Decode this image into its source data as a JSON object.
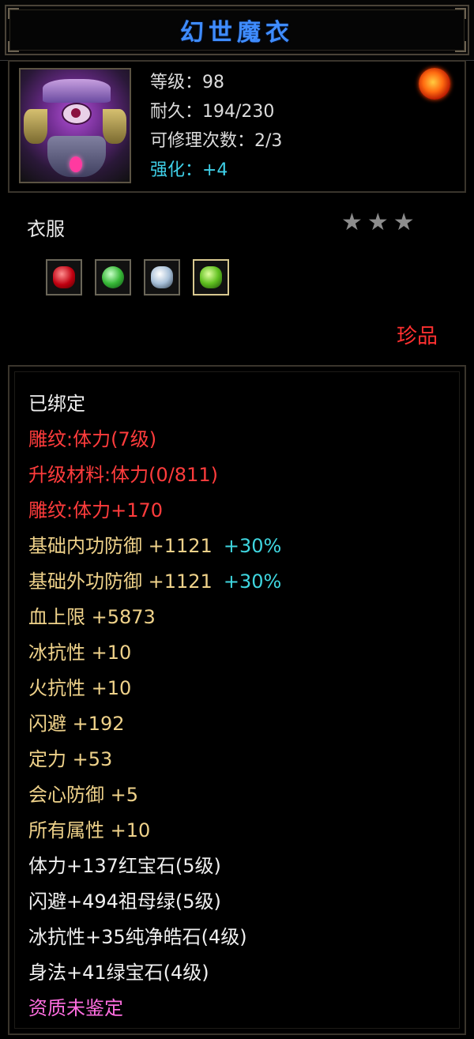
{
  "title": "幻世魔衣",
  "header": {
    "portrait_icon": "robe-armor-portrait",
    "stats": [
      {
        "text": "等级：98"
      },
      {
        "text": "耐久：194/230"
      },
      {
        "text": "可修理次数：2/3"
      },
      {
        "text": "强化：+4"
      }
    ],
    "corner_icon": "dragon-emblem-icon"
  },
  "category": "衣服",
  "stars": "★★★",
  "gems": [
    {
      "name": "ruby-gem-icon"
    },
    {
      "name": "jade-ring-icon"
    },
    {
      "name": "diamond-gem-icon"
    },
    {
      "name": "green-gem-icon"
    }
  ],
  "rarity": "珍品",
  "attributes": [
    {
      "text": "已绑定"
    },
    {
      "text": "雕纹:体力(7级)"
    },
    {
      "text": "升级材料:体力(0/811)"
    },
    {
      "text": "雕纹:体力+170"
    },
    {
      "text": "基础内功防御  +1121",
      "pct": "+30%"
    },
    {
      "text": "基础外功防御  +1121",
      "pct": "+30%"
    },
    {
      "text": "血上限  +5873"
    },
    {
      "text": "冰抗性  +10"
    },
    {
      "text": "火抗性  +10"
    },
    {
      "text": "闪避  +192"
    },
    {
      "text": "定力  +53"
    },
    {
      "text": "会心防御  +5"
    },
    {
      "text": "所有属性  +10"
    },
    {
      "text": "体力+137红宝石(5级)"
    },
    {
      "text": "闪避+494祖母绿(5级)"
    },
    {
      "text": "冰抗性+35纯净皓石(4级)"
    },
    {
      "text": "身法+41绿宝石(4级)"
    },
    {
      "text": "资质未鉴定"
    }
  ],
  "colors": {
    "title": "#3f8cff",
    "engrave": "#ff3c3c",
    "attribute": "#efd28a",
    "percent": "#3fd6e0",
    "aptitude": "#ff6ee0",
    "rarity": "#ff3030"
  }
}
